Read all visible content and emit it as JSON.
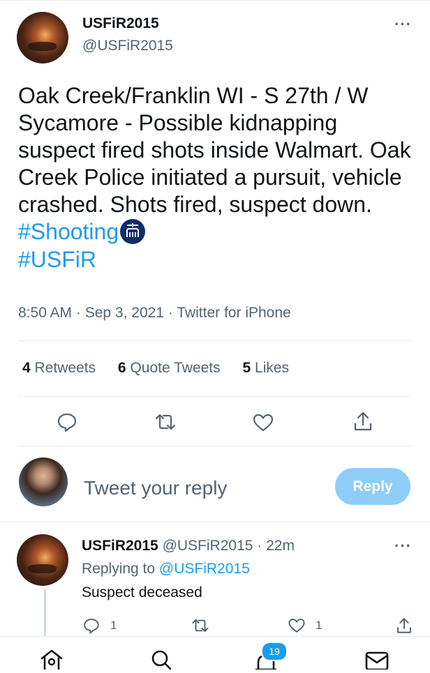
{
  "tweet": {
    "author_name": "USFiR2015",
    "author_handle": "@USFiR2015",
    "more": "···",
    "text_main": "Oak Creek/Franklin WI - S 27th / W Sycamore - Possible kidnapping suspect fired shots inside Walmart. Oak Creek Police initiated a pursuit, vehicle crashed. Shots fired, suspect down. ",
    "hashtag_1": "#Shooting",
    "hashtag_2": "#USFiR",
    "time": "8:50 AM",
    "date": "Sep 3, 2021",
    "source": "Twitter for iPhone",
    "meta_sep": " · "
  },
  "stats": {
    "retweets_count": "4",
    "retweets_label": "Retweets",
    "quotes_count": "6",
    "quotes_label": "Quote Tweets",
    "likes_count": "5",
    "likes_label": "Likes"
  },
  "actions": [
    "reply-icon",
    "retweet-icon",
    "like-icon",
    "share-icon"
  ],
  "composer": {
    "placeholder": "Tweet your reply",
    "button": "Reply"
  },
  "reply": {
    "author_name": "USFiR2015",
    "author_handle": "@USFiR2015",
    "time": "22m",
    "more": "···",
    "replying_prefix": "Replying to ",
    "replying_handle": "@USFiR2015",
    "text": "Suspect deceased",
    "reply_count": "1",
    "like_count": "1"
  },
  "bottom_nav": {
    "items": [
      "home-icon",
      "search-icon",
      "notifications-icon",
      "messages-icon"
    ],
    "notification_badge": "19"
  },
  "colors": {
    "accent": "#1d9bf0",
    "reply_button_disabled": "#8ecdf8",
    "secondary_text": "#536471",
    "divider": "#e6ecf0"
  }
}
